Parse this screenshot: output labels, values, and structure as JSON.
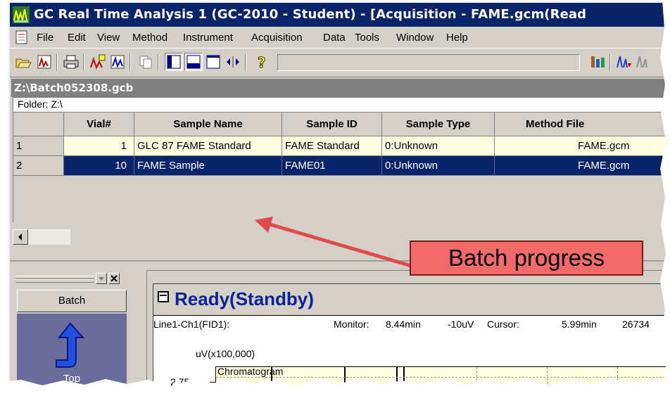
{
  "window": {
    "title": "GC Real Time Analysis 1 (GC-2010 - Student) - [Acquisition - FAME.gcm(Read"
  },
  "menu": {
    "items": [
      "File",
      "Edit",
      "View",
      "Method",
      "Instrument",
      "Acquisition",
      "Data",
      "Tools",
      "Window",
      "Help"
    ]
  },
  "toolbar": {
    "buttons": [
      "open-icon",
      "chart-open-icon",
      "print-icon",
      "data-acquisition-icon",
      "data-acquisition-2-icon",
      "copy-icon",
      "layout-left-icon",
      "layout-bottom-icon",
      "layout-window-icon",
      "arrow-swap-icon",
      "help-icon",
      "instrument-monitor-icon",
      "peak-icon",
      "peak-disabled-icon"
    ]
  },
  "batch": {
    "title": "Z:\\Batch052308.gcb",
    "folder": "Folder: Z:\\",
    "columns": [
      "Vial#",
      "Sample Name",
      "Sample ID",
      "Sample Type",
      "Method File"
    ],
    "rows": [
      {
        "num": "1",
        "vial": "1",
        "sample_name": "GLC 87 FAME Standard",
        "sample_id": "FAME Standard",
        "sample_type": "0:Unknown",
        "method_file": "FAME.gcm"
      },
      {
        "num": "2",
        "vial": "10",
        "sample_name": "FAME Sample",
        "sample_id": "FAME01",
        "sample_type": "0:Unknown",
        "method_file": "FAME.gcm"
      }
    ]
  },
  "assistant": {
    "batch_label": "Batch",
    "top_label": "Top"
  },
  "chromatogram": {
    "status": "Ready(Standby)",
    "channel": "Line1-Ch1(FID1):",
    "monitor_label": "Monitor:",
    "monitor_time": "8.44min",
    "monitor_value": "-10uV",
    "cursor_label": "Cursor:",
    "cursor_time": "5.99min",
    "cursor_value": "26734",
    "y_unit": "uV(x100,000)",
    "y_tick": "2.75",
    "plot_label": "Chromatogram"
  },
  "callout": {
    "text": "Batch progress"
  },
  "colors": {
    "titlebar": "#0a246a",
    "selection": "#0a246a",
    "row_highlight": "#ffffe1",
    "callout_fill": "#f26a6a",
    "status_text": "#0a2496"
  }
}
